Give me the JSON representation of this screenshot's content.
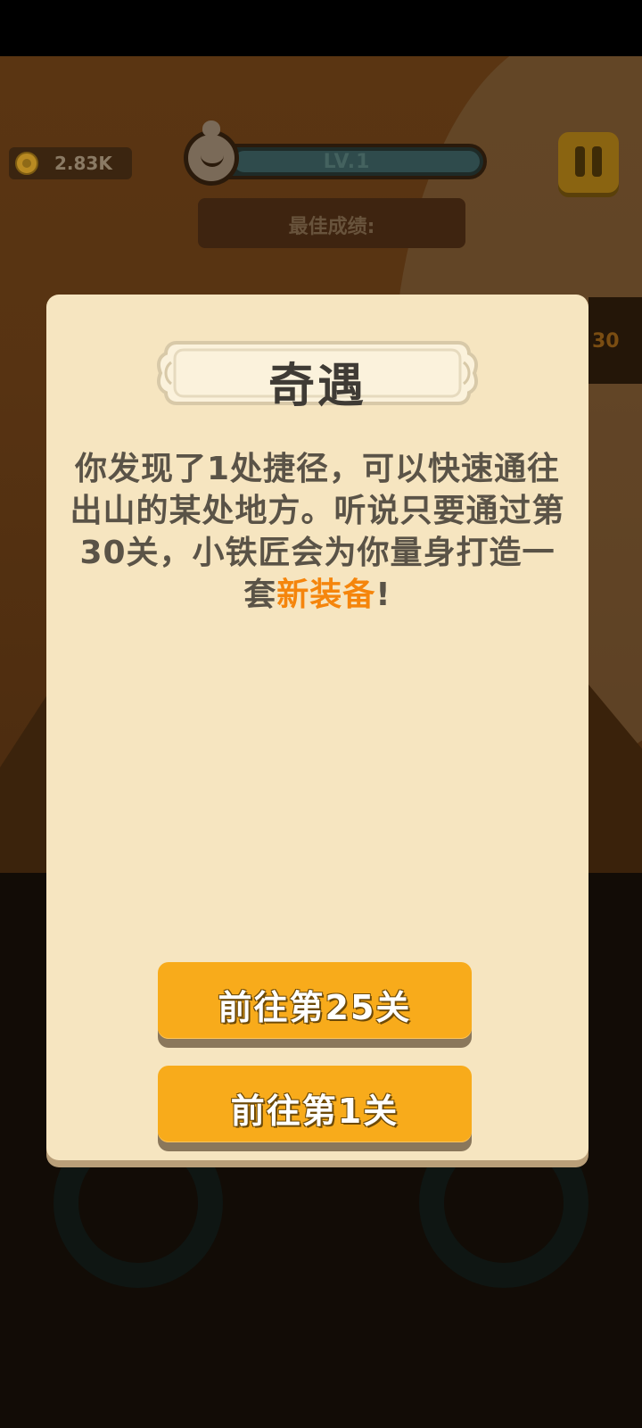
{
  "hud": {
    "coins": "2.83K",
    "level": "LV.1",
    "best_score_label": "最佳成绩:",
    "side_number": "30"
  },
  "dialog": {
    "title": "奇遇",
    "message_part1": "你发现了1处捷径，可以快速通往出山的某处地方。听说只要通过第30关，小铁匠会为你量身打造一套",
    "message_highlight": "新装备",
    "message_part2": "!",
    "buttons": [
      {
        "label": "前往第25关"
      },
      {
        "label": "前往第1关"
      }
    ]
  },
  "colors": {
    "dialog_bg": "#f6e5c0",
    "button": "#f8ab1b",
    "highlight": "#f5850c",
    "title_text": "#3f3b35"
  },
  "icons": [
    "coin-icon",
    "avatar-icon",
    "pause-icon"
  ]
}
